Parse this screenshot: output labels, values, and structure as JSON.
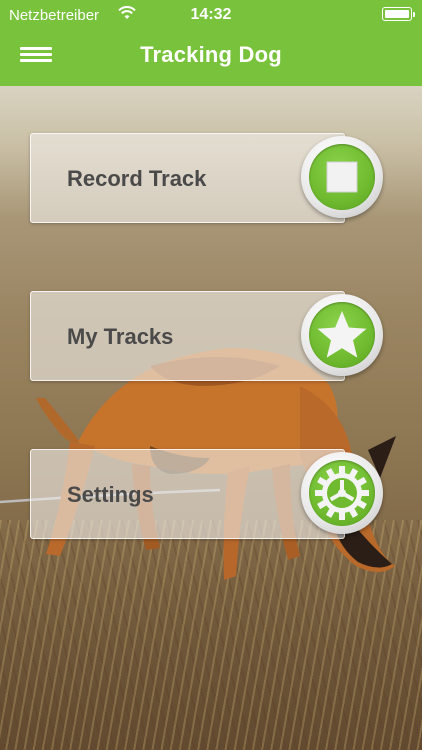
{
  "status_bar": {
    "carrier": "Netzbetreiber",
    "time": "14:32",
    "wifi_icon": "wifi-icon",
    "battery_icon": "battery-icon"
  },
  "nav": {
    "title": "Tracking Dog",
    "menu_icon": "hamburger-menu-icon"
  },
  "menu": [
    {
      "label": "Record Track",
      "icon": "stop-icon"
    },
    {
      "label": "My Tracks",
      "icon": "star-icon"
    },
    {
      "label": "Settings",
      "icon": "gear-icon"
    }
  ],
  "colors": {
    "accent": "#78c23c",
    "button_green": "#6fba2f",
    "label_text": "#4a4a4a"
  }
}
